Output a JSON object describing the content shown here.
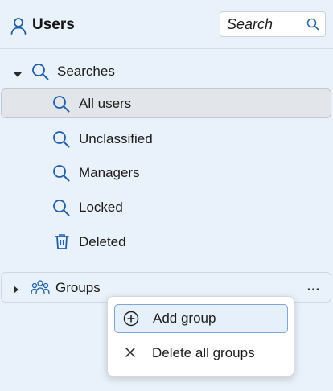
{
  "header": {
    "title": "Users",
    "icon": "user-icon",
    "search": {
      "placeholder": "Search",
      "value": "",
      "icon": "search-icon"
    }
  },
  "tree": {
    "searches": {
      "label": "Searches",
      "expanded": true,
      "icon": "search-icon",
      "items": [
        {
          "label": "All users",
          "icon": "search-icon",
          "selected": true
        },
        {
          "label": "Unclassified",
          "icon": "search-icon"
        },
        {
          "label": "Managers",
          "icon": "search-icon"
        },
        {
          "label": "Locked",
          "icon": "search-icon"
        },
        {
          "label": "Deleted",
          "icon": "trash-icon"
        }
      ]
    },
    "groups": {
      "label": "Groups",
      "expanded": false,
      "icon": "people-group-icon",
      "more_label": "…"
    }
  },
  "context_menu": {
    "items": [
      {
        "label": "Add group",
        "icon": "plus-circle-icon",
        "highlighted": true
      },
      {
        "label": "Delete all groups",
        "icon": "close-icon"
      }
    ]
  },
  "colors": {
    "panel_background": "#e9f1fa",
    "accent": "#1f5ea8",
    "selection_background": "#e2e5e9",
    "menu_highlight": "#e6f0fb"
  }
}
